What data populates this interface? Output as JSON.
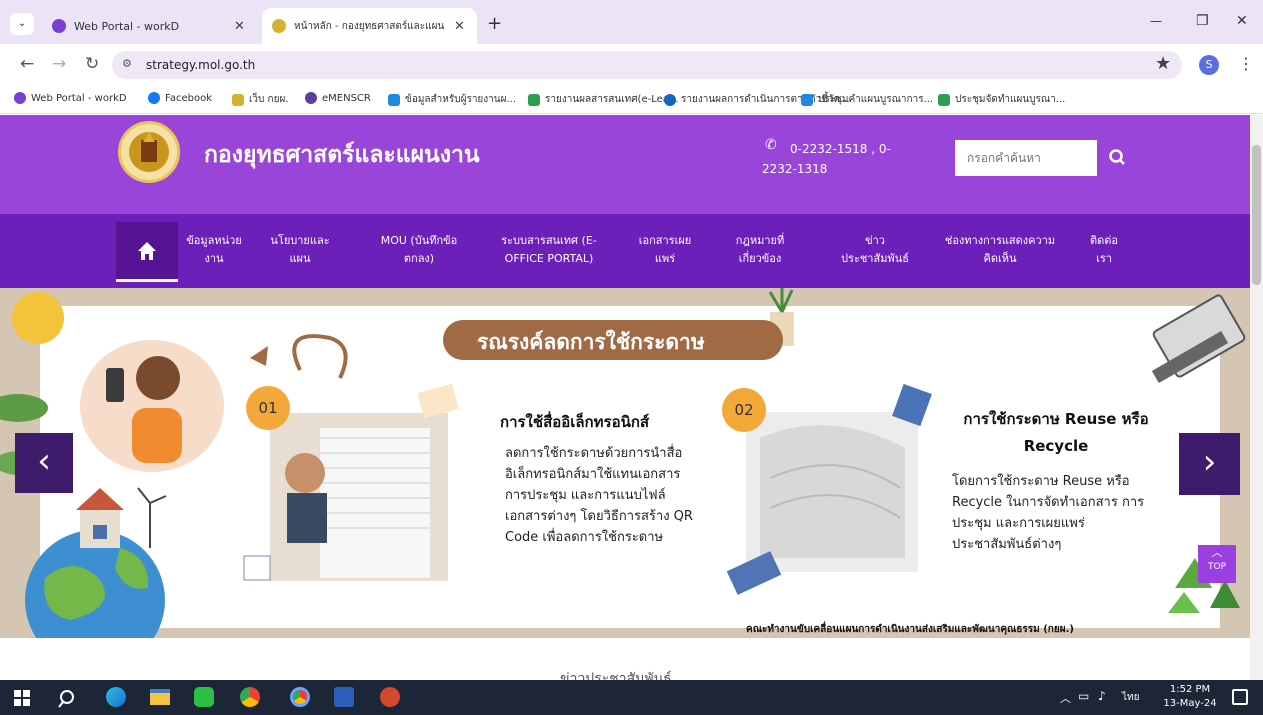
{
  "browser": {
    "tabs": [
      {
        "title": "Web Portal - workD",
        "favicon_color": "#7b3fd0"
      },
      {
        "title": "หน้าหลัก - กองยุทธศาสตร์และแผนงาน",
        "favicon_color": "#d8b030"
      }
    ],
    "new_tab_label": "+",
    "window_controls": {
      "minimize": "—",
      "restore": "❐",
      "close": "✕"
    },
    "url": "strategy.mol.go.th",
    "profile_initial": "S",
    "bookmarks": [
      {
        "label": "Web Portal - workD",
        "color": "#7b3fd0"
      },
      {
        "label": "Facebook",
        "color": "#1877f2"
      },
      {
        "label": "เว็บ กยผ.",
        "color": "#d8b030"
      },
      {
        "label": "eMENSCR",
        "color": "#5a3fa0"
      },
      {
        "label": "ข้อมูลสำหรับผู้รายงานผ...",
        "color": "#1e88e5"
      },
      {
        "label": "รายงานผลสารสนเทศ(e-Lea...",
        "color": "#2e9e4f"
      },
      {
        "label": "รายงานผลการดำเนินการตามตัวชี้วัด...",
        "color": "#1565c0"
      },
      {
        "label": "ประชุมคำแผนบูรณาการ...",
        "color": "#1e88e5"
      },
      {
        "label": "ประชุมจัดทำแผนบูรณา...",
        "color": "#2e9e4f"
      }
    ]
  },
  "site": {
    "title": "กองยุทธศาสตร์และแผนงาน",
    "phone": "0-2232-1518 , 0-2232-1318",
    "search_placeholder": "กรอกคำค้นหา",
    "nav": [
      {
        "line1": "ข้อมูลหน่วย",
        "line2": "งาน"
      },
      {
        "line1": "นโยบายและ",
        "line2": "แผน"
      },
      {
        "line1": "MOU (บันทึกข้อ",
        "line2": "ตกลง)"
      },
      {
        "line1": "ระบบสารสนเทศ (E-",
        "line2": "OFFICE PORTAL)"
      },
      {
        "line1": "เอกสารเผย",
        "line2": "แพร่"
      },
      {
        "line1": "กฎหมายที่",
        "line2": "เกี่ยวข้อง"
      },
      {
        "line1": "ข่าว",
        "line2": "ประชาสัมพันธ์"
      },
      {
        "line1": "ช่องทางการแสดงความ",
        "line2": "คิดเห็น"
      },
      {
        "line1": "ติดต่อ",
        "line2": "เรา"
      }
    ]
  },
  "slide": {
    "heading": "รณรงค์ลดการใช้กระดาษ",
    "item1": {
      "number": "01",
      "title": "การใช้สื่ออิเล็กทรอนิกส์",
      "body": "ลดการใช้กระดาษด้วยการนำสื่ออิเล็กทรอนิกส์มาใช้แทนเอกสารการประชุม และการแนบไฟล์เอกสารต่างๆ โดยวิธีการสร้าง QR Code เพื่อลดการใช้กระดาษ"
    },
    "item2": {
      "number": "02",
      "title": "การใช้กระดาษ Reuse หรือ Recycle",
      "body": "โดยการใช้กระดาษ Reuse หรือ Recycle ในการจัดทำเอกสาร การประชุม และการเผยแพร่ประชาสัมพันธ์ต่างๆ"
    },
    "footer": "คณะทำงานขับเคลื่อนแผนการดำเนินงานส่งเสริมและพัฒนาคุณธรรม (กยผ.)",
    "prev_label": "‹",
    "next_label": "›",
    "top_button": "TOP"
  },
  "below_fold_text": "ข่าวประชาสัมพันธ์",
  "taskbar": {
    "time": "1:52 PM",
    "date": "13-May-24",
    "lang": "ไทย"
  },
  "colors": {
    "header": "#9945d9",
    "nav": "#6d1fba",
    "accent_orange": "#f3a93a",
    "heading_pill": "#a06a45"
  }
}
